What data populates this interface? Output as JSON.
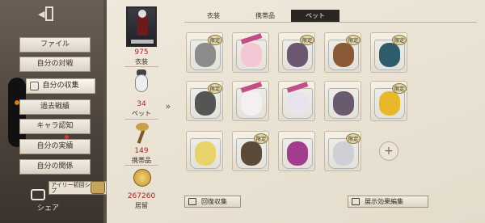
{
  "sidebar": {
    "items": [
      {
        "label": "ファイル"
      },
      {
        "label": "自分の対戦"
      },
      {
        "label": "自分の収集"
      },
      {
        "label": "過去戦績"
      },
      {
        "label": "キャラ認知"
      },
      {
        "label": "自分の実績"
      },
      {
        "label": "自分の関係"
      }
    ],
    "tip": "アイリー初回ショップ",
    "share": "シェア"
  },
  "stats": {
    "costume_count": "975",
    "costume_label": "衣装",
    "pet_count": "34",
    "pet_label": "ペット",
    "item_count": "149",
    "item_label": "携帯品",
    "coin_count": "267260",
    "coin_label": "居留"
  },
  "tabs": [
    {
      "label": "衣装"
    },
    {
      "label": "携帯品"
    },
    {
      "label": "ペット"
    }
  ],
  "grid": {
    "tag_label": "限定",
    "add_symbol": "+"
  },
  "bottom": {
    "left_button": "回復収集",
    "right_button": "展示効果編集"
  },
  "colors": {
    "accent_red": "#a22222",
    "tab_active_bg": "#2a2622"
  }
}
